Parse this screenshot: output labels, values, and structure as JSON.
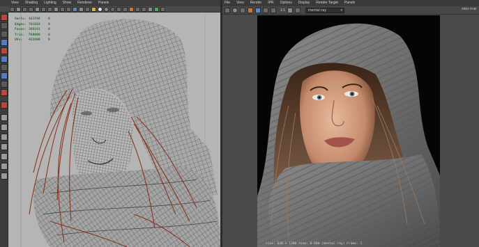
{
  "left_panel": {
    "menu": [
      "View",
      "Shading",
      "Lighting",
      "Show",
      "Renderer",
      "Panels"
    ],
    "hud": [
      {
        "label": "Verts:",
        "value": "423786",
        "count": "0"
      },
      {
        "label": "Edges:",
        "value": "781503",
        "count": "0"
      },
      {
        "label": "Faces:",
        "value": "368191",
        "count": "0"
      },
      {
        "label": "Tris:",
        "value": "768090",
        "count": "0"
      },
      {
        "label": "UVs:",
        "value": "422890",
        "count": "0"
      }
    ]
  },
  "render_view": {
    "menu": [
      "File",
      "View",
      "Render",
      "IPR",
      "Options",
      "Display",
      "Render Target",
      "Panels"
    ],
    "ratio": "1:1",
    "renderer": "mental ray",
    "side_info": "RBG 0AB",
    "status": "size: 638 x 1280  zoom: 0.600     (mental ray)  Frame: 1"
  },
  "colors": {
    "ui_dark": "#3c3c3c",
    "viewport_bg": "#b5b5b5",
    "render_bg": "#050505",
    "hud_text": "#2f6b3a",
    "hair_red": "#8a2a14"
  },
  "icons": {
    "select": "select-arrow-icon",
    "render": "render-clapper-icon",
    "ipr": "ipr-render-icon",
    "snapshot": "snapshot-icon"
  }
}
